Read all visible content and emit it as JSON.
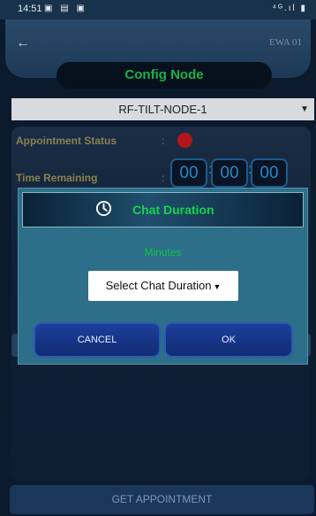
{
  "status_bar": {
    "time": "14:51",
    "left_icons": "▣ ▤ ▣",
    "right_icons": "⁴ᴳ.ıl ▮"
  },
  "app_bar": {
    "back_glyph": "←",
    "device_code": "EWA 01",
    "title": "Config Node"
  },
  "node_selector": {
    "value": "RF-TILT-NODE-1",
    "caret": "▼"
  },
  "appointment": {
    "label": "Appointment Status",
    "colon": ":",
    "status_color": "#b3161a"
  },
  "time_remaining": {
    "label": "Time Remaining",
    "colon": ":",
    "hours": "00",
    "minutes": "00",
    "seconds": "00",
    "separator": ":"
  },
  "dialog": {
    "title": "Chat Duration",
    "unit_label": "Minutes",
    "select_value": "Select Chat Duration",
    "select_caret": "▼",
    "cancel_label": "CANCEL",
    "ok_label": "OK"
  },
  "footer": {
    "get_appointment_label": "GET APPOINTMENT"
  },
  "colors": {
    "accent_green": "#16c24c",
    "button_blue": "#1c3f9a",
    "background": "#0c1a2e"
  }
}
